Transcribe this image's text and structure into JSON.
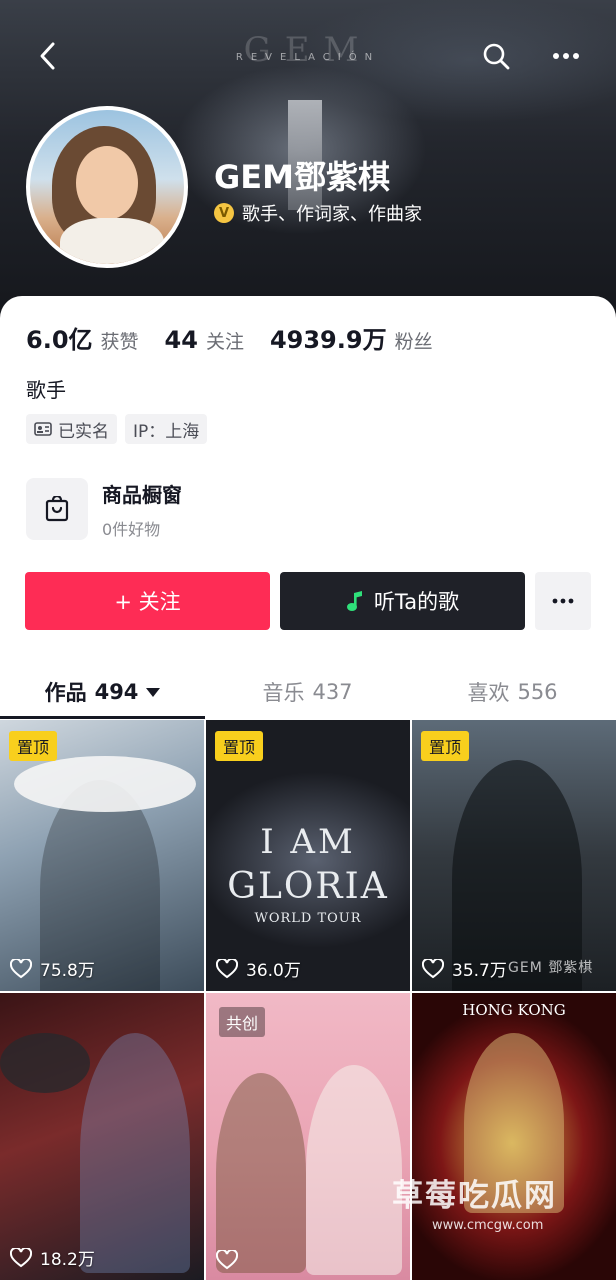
{
  "header": {
    "banner_logo": "GEM",
    "banner_sub": "REVELACIÓN",
    "back_icon": "back-arrow-icon",
    "search_icon": "search-icon",
    "more_icon": "more-icon"
  },
  "profile": {
    "name": "GEM鄧紫棋",
    "verified_icon": "verified-badge-icon",
    "verified_mark": "V",
    "verified_text": "歌手、作词家、作曲家"
  },
  "stats": [
    {
      "value": "6.0亿",
      "label": "获赞"
    },
    {
      "value": "44",
      "label": "关注"
    },
    {
      "value": "4939.9万",
      "label": "粉丝"
    }
  ],
  "bio": "歌手",
  "tags": [
    {
      "icon": "id-card-icon",
      "text": "已实名"
    },
    {
      "icon": "",
      "text": "IP：上海"
    }
  ],
  "shop": {
    "icon": "shopping-bag-icon",
    "title": "商品橱窗",
    "subtitle": "0件好物"
  },
  "actions": {
    "follow_label": "+ 关注",
    "listen_label": "听Ta的歌",
    "listen_icon": "music-note-icon",
    "more_icon": "more-icon"
  },
  "tabs": [
    {
      "label": "作品",
      "count": "494",
      "active": true
    },
    {
      "label": "音乐",
      "count": "437",
      "active": false
    },
    {
      "label": "喜欢",
      "count": "556",
      "active": false
    }
  ],
  "videos": [
    {
      "badge": "置顶",
      "likes": "75.8万"
    },
    {
      "badge": "置顶",
      "likes": "36.0万",
      "overlay_lines": [
        "I AM",
        "GLORIA",
        "WORLD TOUR"
      ]
    },
    {
      "badge": "置顶",
      "likes": "35.7万",
      "overlay_text": "GEM 鄧紫棋"
    },
    {
      "badge": "",
      "likes": "18.2万"
    },
    {
      "badge": "共创",
      "likes": ""
    },
    {
      "badge": "",
      "likes": "",
      "overlay_text": "HONG KONG"
    }
  ],
  "watermark": {
    "text": "草莓吃瓜网",
    "url": "www.cmcgw.com"
  },
  "colors": {
    "follow_bg": "#fe2c55",
    "listen_bg": "#1f2128",
    "pin_bg": "#f8cf1d",
    "text_primary": "#161823",
    "text_secondary": "#8a8b91"
  }
}
